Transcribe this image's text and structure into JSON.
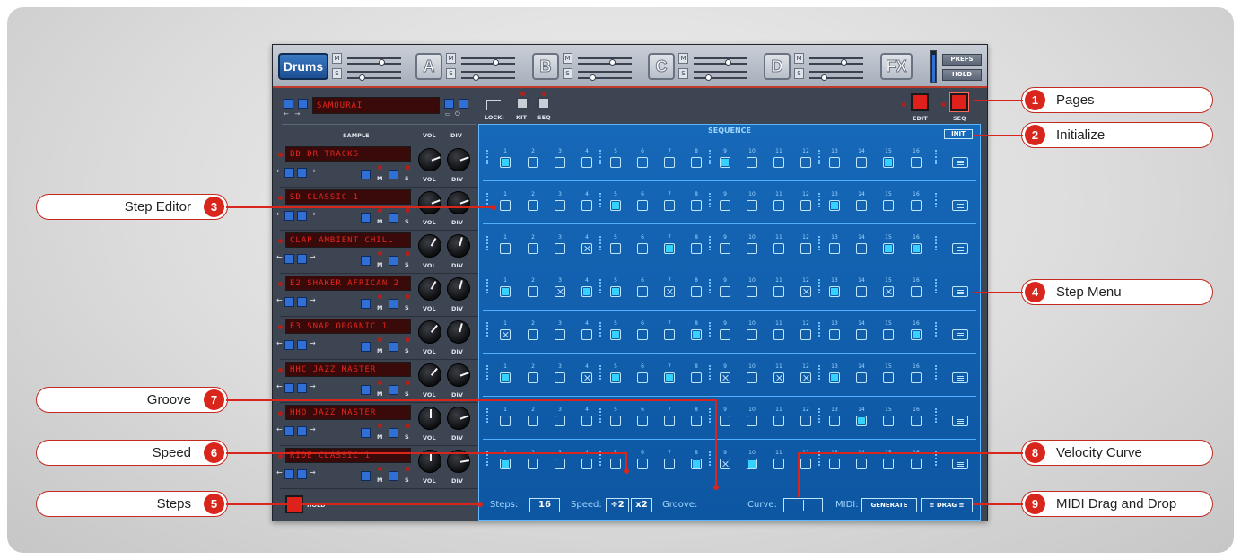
{
  "top_bar": {
    "pages": [
      "Drums",
      "A",
      "B",
      "C",
      "D",
      "FX"
    ],
    "mute_label": "M",
    "solo_label": "S",
    "prefs_label": "PREFS",
    "hold_label": "HOLD"
  },
  "kit": {
    "kit_name": "SAMOURAI",
    "lock_label": "LOCK:",
    "kit_label": "KIT",
    "seq_label": "SEQ",
    "edit_label": "EDIT",
    "seq_page_label": "SEQ"
  },
  "mixer_headers": {
    "sample": "SAMPLE",
    "vol": "VOL",
    "div": "DIV"
  },
  "tracks": [
    {
      "sample": "BD DR TRACKS",
      "vol_angle": 70,
      "div_angle": 70
    },
    {
      "sample": "SD CLASSIC 1",
      "vol_angle": 70,
      "div_angle": 70
    },
    {
      "sample": "CLAP AMBIENT CHILL",
      "vol_angle": 30,
      "div_angle": 15
    },
    {
      "sample": "E2 SHAKER AFRICAN 2",
      "vol_angle": 30,
      "div_angle": 15
    },
    {
      "sample": "E3 SNAP ORGANIC 1",
      "vol_angle": 40,
      "div_angle": 15
    },
    {
      "sample": "HHC JAZZ MASTER",
      "vol_angle": 40,
      "div_angle": 70
    },
    {
      "sample": "HHO JAZZ MASTER",
      "vol_angle": 0,
      "div_angle": 70
    },
    {
      "sample": "RIDE CLASSIC 1",
      "vol_angle": 0,
      "div_angle": 80
    }
  ],
  "hold_bottom_label": "HOLD",
  "sequence": {
    "title": "SEQUENCE",
    "init_label": "INIT",
    "step_numbers": [
      "1",
      "2",
      "3",
      "4",
      "5",
      "6",
      "7",
      "8",
      "9",
      "10",
      "11",
      "12",
      "13",
      "14",
      "15",
      "16"
    ],
    "rows": [
      "1000000010000010",
      "0000100000001000",
      "000x001000000011",
      "10x110x0000x10x0",
      "x000100100000001",
      "100x1010x0xx1000",
      "0000000000000100",
      "10000001x1000000"
    ]
  },
  "bottom_bar": {
    "steps_label": "Steps:",
    "steps_value": "16",
    "speed_label": "Speed:",
    "speed_div": "÷2",
    "speed_mul": "x2",
    "groove_label": "Groove:",
    "curve_label": "Curve:",
    "midi_label": "MIDI:",
    "generate_label": "GENERATE",
    "drag_label": "≡ DRAG ≡"
  },
  "callouts": {
    "c1": {
      "num": "1",
      "label": "Pages"
    },
    "c2": {
      "num": "2",
      "label": "Initialize"
    },
    "c3": {
      "num": "3",
      "label": "Step Editor"
    },
    "c4": {
      "num": "4",
      "label": "Step Menu"
    },
    "c5": {
      "num": "5",
      "label": "Steps"
    },
    "c6": {
      "num": "6",
      "label": "Speed"
    },
    "c7": {
      "num": "7",
      "label": "Groove"
    },
    "c8": {
      "num": "8",
      "label": "Velocity Curve"
    },
    "c9": {
      "num": "9",
      "label": "MIDI Drag and Drop"
    }
  },
  "colors": {
    "accent": "#d9261c",
    "sequence_blue": "#1668b8",
    "lcd_red": "#e5261e"
  }
}
